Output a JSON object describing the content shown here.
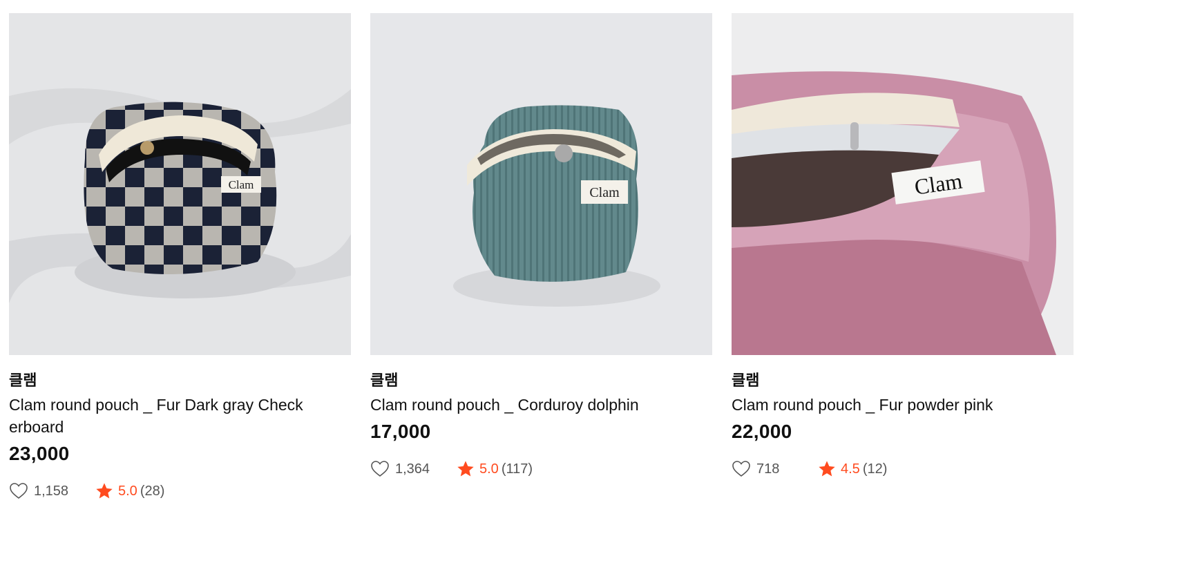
{
  "colors": {
    "accent": "#ff4b1f",
    "text": "#111111",
    "muted": "#555555"
  },
  "products": [
    {
      "brand": "클램",
      "title": "Clam round pouch _ Fur Dark gray Check erboard",
      "price": "23,000",
      "likes": "1,158",
      "rating": "5.0",
      "reviews": "(28)",
      "label": "Clam"
    },
    {
      "brand": "클램",
      "title": "Clam round pouch _ Corduroy dolphin",
      "price": "17,000",
      "likes": "1,364",
      "rating": "5.0",
      "reviews": "(117)",
      "label": "Clam"
    },
    {
      "brand": "클램",
      "title": "Clam round pouch _ Fur powder pink",
      "price": "22,000",
      "likes": "718",
      "rating": "4.5",
      "reviews": "(12)",
      "label": "Clam"
    }
  ]
}
